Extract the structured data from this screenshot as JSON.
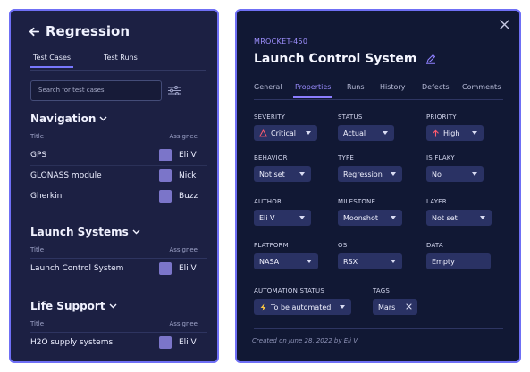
{
  "left": {
    "title": "Regression",
    "tabs": [
      {
        "label": "Test Cases"
      },
      {
        "label": "Test Runs"
      }
    ],
    "search": {
      "placeholder": "Search for test cases"
    },
    "sections": [
      {
        "title": "Navigation",
        "col_title": "Title",
        "col_assignee": "Assignee",
        "rows": [
          {
            "name": "GPS",
            "assignee": "Eli V"
          },
          {
            "name": "GLONASS module",
            "assignee": "Nick"
          },
          {
            "name": "Gherkin",
            "assignee": "Buzz"
          }
        ]
      },
      {
        "title": "Launch Systems",
        "col_title": "Title",
        "col_assignee": "Assignee",
        "rows": [
          {
            "name": "Launch Control System",
            "assignee": "Eli V"
          }
        ]
      },
      {
        "title": "Life Support",
        "col_title": "Title",
        "col_assignee": "Assignee",
        "rows": [
          {
            "name": "H2O supply systems",
            "assignee": "Eli V"
          }
        ]
      }
    ]
  },
  "right": {
    "id": "MROCKET-450",
    "title": "Launch Control System",
    "tabs": [
      {
        "label": "General"
      },
      {
        "label": "Properties"
      },
      {
        "label": "Runs"
      },
      {
        "label": "History"
      },
      {
        "label": "Defects"
      },
      {
        "label": "Comments"
      }
    ],
    "active_tab": "Properties",
    "fields": {
      "severity": {
        "label": "SEVERITY",
        "value": "Critical",
        "icon": "warning-triangle-icon"
      },
      "status": {
        "label": "STATUS",
        "value": "Actual"
      },
      "priority": {
        "label": "PRIORITY",
        "value": "High",
        "icon": "arrow-up-icon"
      },
      "behavior": {
        "label": "BEHAVIOR",
        "value": "Not set"
      },
      "type": {
        "label": "TYPE",
        "value": "Regression"
      },
      "is_flaky": {
        "label": "IS FLAKY",
        "value": "No"
      },
      "author": {
        "label": "AUTHOR",
        "value": "Eli V"
      },
      "milestone": {
        "label": "MILESTONE",
        "value": "Moonshot"
      },
      "layer": {
        "label": "LAYER",
        "value": "Not set"
      },
      "platform": {
        "label": "PLATFORM",
        "value": "NASA"
      },
      "os": {
        "label": "OS",
        "value": "RSX"
      },
      "data": {
        "label": "DATA",
        "value": "Empty"
      },
      "automation_status": {
        "label": "AUTOMATION STATUS",
        "value": "To be automated",
        "icon": "lightning-icon"
      },
      "tags": {
        "label": "TAGS",
        "value": "Mars"
      }
    },
    "footer": "Created on June 28, 2022 by Eli V"
  },
  "colors": {
    "panel_border": "#6f6ff5",
    "accent": "#8b7dff",
    "severity_critical": "#ff5b6e",
    "priority_high": "#ff5b6e",
    "automation_icon": "#f6c343",
    "avatar": "#7b75c9"
  }
}
